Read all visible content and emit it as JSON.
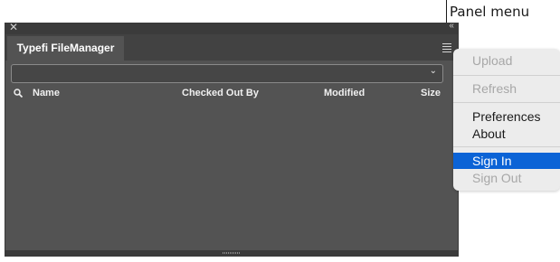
{
  "callout": {
    "label": "Panel menu"
  },
  "panel": {
    "tab_label": "Typefi FileManager",
    "dropdown_value": "",
    "columns": [
      "Name",
      "Checked Out By",
      "Modified",
      "Size"
    ]
  },
  "menu": {
    "upload": "Upload",
    "refresh": "Refresh",
    "preferences": "Preferences",
    "about": "About",
    "sign_in": "Sign In",
    "sign_out": "Sign Out"
  },
  "colors": {
    "panel_bg": "#535353",
    "menu_bg": "#ececec",
    "highlight": "#0b63d6"
  }
}
